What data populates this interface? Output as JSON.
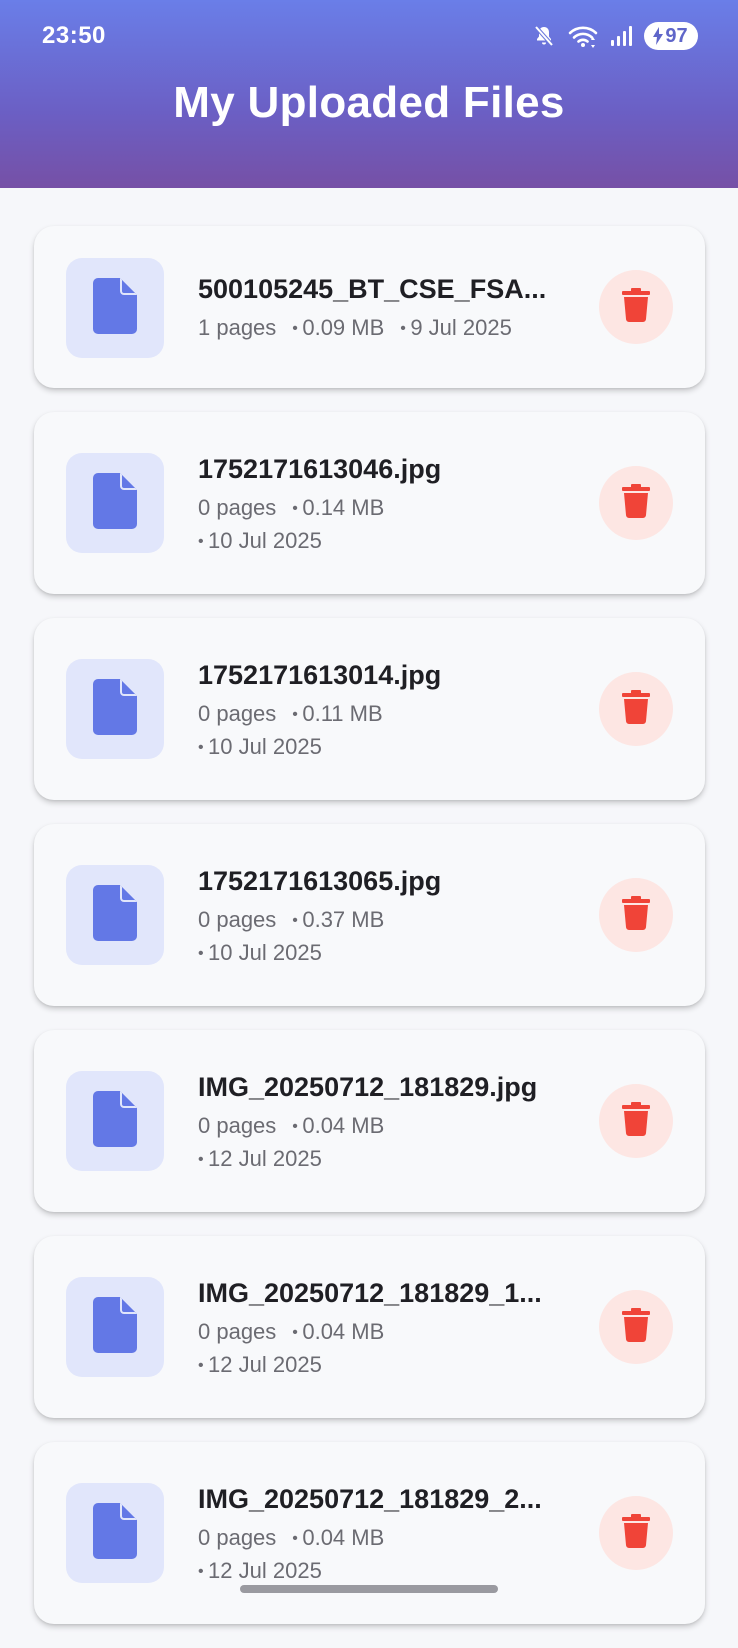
{
  "status_bar": {
    "time": "23:50",
    "battery_level": "97",
    "icons": [
      "mute-icon",
      "wifi-icon",
      "signal-icon",
      "charging-icon"
    ]
  },
  "header": {
    "title": "My Uploaded Files"
  },
  "colors": {
    "header_gradient_start": "#6a7ee8",
    "header_gradient_end": "#7650a6",
    "file_icon": "#6378e6",
    "file_icon_bg": "#e1e6fb",
    "delete_icon": "#f04438",
    "delete_bg": "#fde6e3"
  },
  "files": [
    {
      "name": "500105245_BT_CSE_FSA...",
      "pages": "1 pages",
      "size": "0.09 MB",
      "date": "9 Jul 2025"
    },
    {
      "name": "1752171613046.jpg",
      "pages": "0 pages",
      "size": "0.14 MB",
      "date": "10 Jul 2025"
    },
    {
      "name": "1752171613014.jpg",
      "pages": "0 pages",
      "size": "0.11 MB",
      "date": "10 Jul 2025"
    },
    {
      "name": "1752171613065.jpg",
      "pages": "0 pages",
      "size": "0.37 MB",
      "date": "10 Jul 2025"
    },
    {
      "name": "IMG_20250712_181829.jpg",
      "pages": "0 pages",
      "size": "0.04 MB",
      "date": "12 Jul 2025"
    },
    {
      "name": "IMG_20250712_181829_1...",
      "pages": "0 pages",
      "size": "0.04 MB",
      "date": "12 Jul 2025"
    },
    {
      "name": "IMG_20250712_181829_2...",
      "pages": "0 pages",
      "size": "0.04 MB",
      "date": "12 Jul 2025"
    }
  ]
}
